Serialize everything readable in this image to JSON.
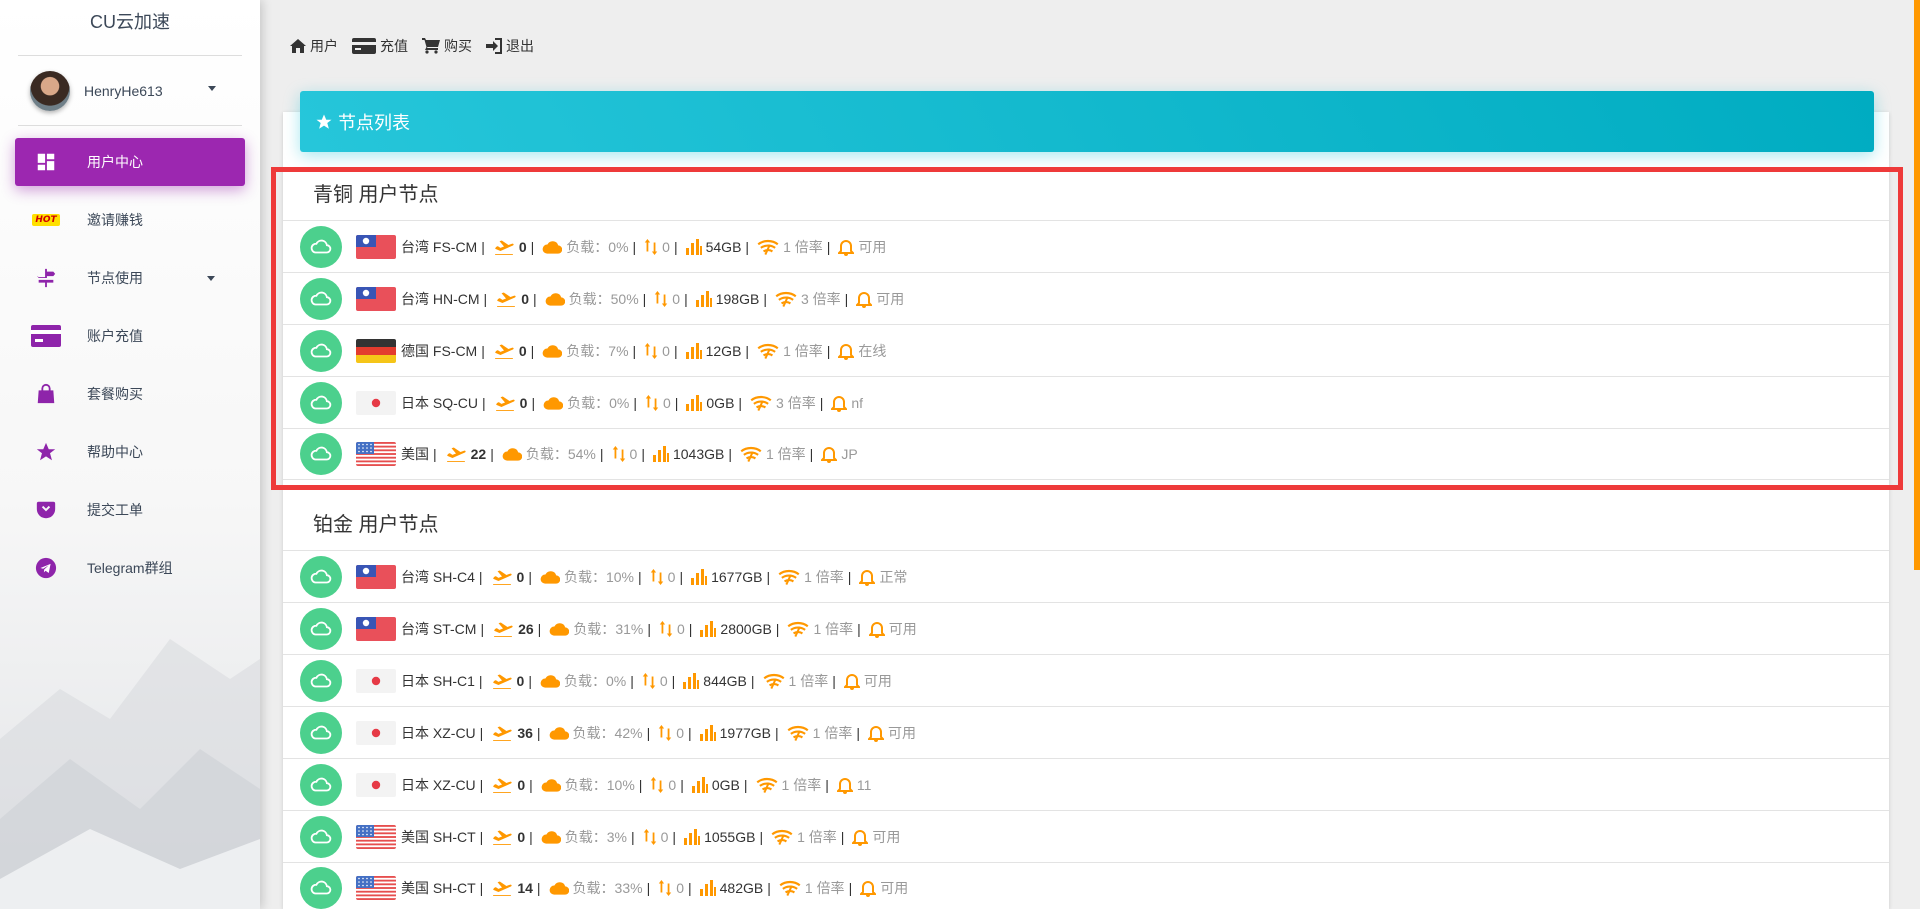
{
  "sidebar": {
    "brand": "CU云加速",
    "username": "HenryHe613",
    "items": [
      {
        "label": "用户中心",
        "icon": "dashboard-icon",
        "active": true
      },
      {
        "label": "邀请赚钱",
        "icon": "hot-badge",
        "badge": "HOT"
      },
      {
        "label": "节点使用",
        "icon": "signpost-icon",
        "has_submenu": true
      },
      {
        "label": "账户充值",
        "icon": "credit-card-icon"
      },
      {
        "label": "套餐购买",
        "icon": "shopping-bag-icon"
      },
      {
        "label": "帮助中心",
        "icon": "star-icon"
      },
      {
        "label": "提交工单",
        "icon": "pocket-icon"
      },
      {
        "label": "Telegram群组",
        "icon": "telegram-icon"
      }
    ]
  },
  "topnav": [
    {
      "label": "用户",
      "icon": "home-icon"
    },
    {
      "label": "充值",
      "icon": "credit-card-icon"
    },
    {
      "label": "购买",
      "icon": "cart-icon"
    },
    {
      "label": "退出",
      "icon": "sign-out-icon"
    }
  ],
  "card": {
    "title": "节点列表"
  },
  "labels": {
    "load_prefix": "负载：",
    "rate_suffix": "倍率"
  },
  "groups": [
    {
      "title": "青铜 用户节点",
      "nodes": [
        {
          "flag": "taiwan",
          "name": "台湾 FS-CM",
          "users": "0",
          "load": "0%",
          "speed": "0",
          "traffic": "54GB",
          "rate": "1",
          "status": "可用"
        },
        {
          "flag": "taiwan",
          "name": "台湾 HN-CM",
          "users": "0",
          "load": "50%",
          "speed": "0",
          "traffic": "198GB",
          "rate": "3",
          "status": "可用"
        },
        {
          "flag": "germany",
          "name": "德国 FS-CM",
          "users": "0",
          "load": "7%",
          "speed": "0",
          "traffic": "12GB",
          "rate": "1",
          "status": "在线"
        },
        {
          "flag": "japan",
          "name": "日本 SQ-CU",
          "users": "0",
          "load": "0%",
          "speed": "0",
          "traffic": "0GB",
          "rate": "3",
          "status": "nf"
        },
        {
          "flag": "usa",
          "name": "美国",
          "users": "22",
          "load": "54%",
          "speed": "0",
          "traffic": "1043GB",
          "rate": "1",
          "status": "JP"
        }
      ]
    },
    {
      "title": "铂金 用户节点",
      "nodes": [
        {
          "flag": "taiwan",
          "name": "台湾 SH-C4",
          "users": "0",
          "load": "10%",
          "speed": "0",
          "traffic": "1677GB",
          "rate": "1",
          "status": "正常"
        },
        {
          "flag": "taiwan",
          "name": "台湾 ST-CM",
          "users": "26",
          "load": "31%",
          "speed": "0",
          "traffic": "2800GB",
          "rate": "1",
          "status": "可用"
        },
        {
          "flag": "japan",
          "name": "日本 SH-C1",
          "users": "0",
          "load": "0%",
          "speed": "0",
          "traffic": "844GB",
          "rate": "1",
          "status": "可用"
        },
        {
          "flag": "japan",
          "name": "日本 XZ-CU",
          "users": "36",
          "load": "42%",
          "speed": "0",
          "traffic": "1977GB",
          "rate": "1",
          "status": "可用"
        },
        {
          "flag": "japan",
          "name": "日本 XZ-CU",
          "users": "0",
          "load": "10%",
          "speed": "0",
          "traffic": "0GB",
          "rate": "1",
          "status": "11"
        },
        {
          "flag": "usa",
          "name": "美国 SH-CT",
          "users": "0",
          "load": "3%",
          "speed": "0",
          "traffic": "1055GB",
          "rate": "1",
          "status": "可用"
        },
        {
          "flag": "usa",
          "name": "美国 SH-CT",
          "users": "14",
          "load": "33%",
          "speed": "0",
          "traffic": "482GB",
          "rate": "1",
          "status": "可用"
        }
      ]
    }
  ],
  "colors": {
    "accent_purple": "#9c27b0",
    "header_cyan": "#00bcd4",
    "status_green": "#4cd08d",
    "icon_orange": "#ff9800",
    "highlight_red": "#ee3a3a"
  }
}
